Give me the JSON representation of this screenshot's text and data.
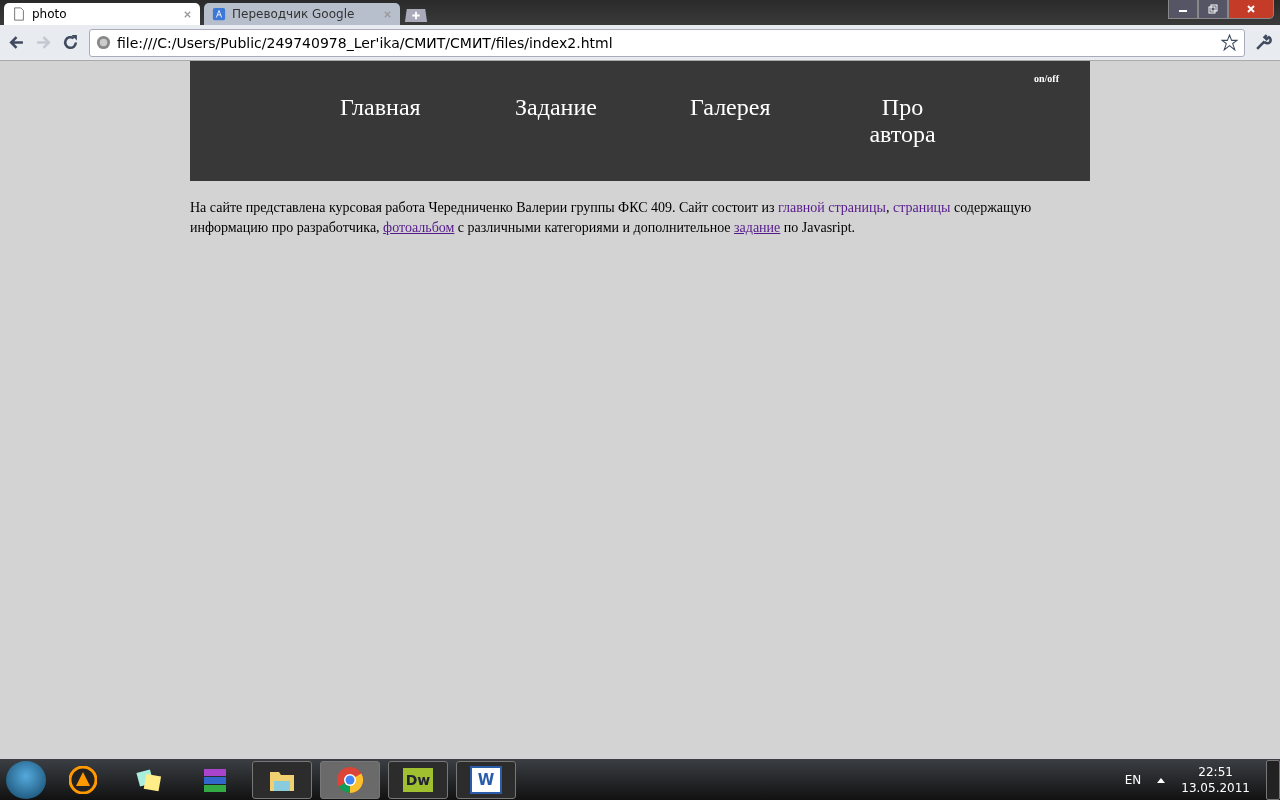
{
  "browser": {
    "tabs": [
      {
        "label": "photo",
        "selected": true,
        "kind": "page"
      },
      {
        "label": "Переводчик Google",
        "selected": false,
        "kind": "translate"
      }
    ],
    "address": "file:///C:/Users/Public/249740978_Ler'ika/СМИТ/СМИТ/files/index2.html",
    "forward_disabled": true
  },
  "page": {
    "toggle": "on/off",
    "nav": [
      {
        "label": "Главная"
      },
      {
        "label": "Задание"
      },
      {
        "label": "Галерея"
      },
      {
        "label": "Про автора"
      }
    ],
    "paragraph": [
      {
        "kind": "text",
        "text": "На сайте представлена курсовая работа Чередниченко Валерии группы ФКС 409. Сайт состоит из "
      },
      {
        "kind": "link",
        "text": "главной страницы",
        "underlined": false
      },
      {
        "kind": "text",
        "text": ", "
      },
      {
        "kind": "link",
        "text": "страницы",
        "underlined": false
      },
      {
        "kind": "text",
        "text": " содержащую информацию про разработчика, "
      },
      {
        "kind": "link",
        "text": "фотоальбом",
        "underlined": true
      },
      {
        "kind": "text",
        "text": " с различными категориями и дополнительное "
      },
      {
        "kind": "link",
        "text": "задание",
        "underlined": true
      },
      {
        "kind": "text",
        "text": " по Javasript."
      }
    ]
  },
  "taskbar": {
    "apps": [
      {
        "kind": "aimp",
        "running": false,
        "selected": false
      },
      {
        "kind": "notes",
        "running": false,
        "selected": false
      },
      {
        "kind": "archive",
        "running": false,
        "selected": false
      },
      {
        "kind": "folder",
        "running": true,
        "selected": false
      },
      {
        "kind": "chrome",
        "running": true,
        "selected": true
      },
      {
        "kind": "dw",
        "running": true,
        "selected": false,
        "label": "Dw"
      },
      {
        "kind": "word",
        "running": true,
        "selected": false,
        "label": "W"
      }
    ],
    "language": "EN",
    "time": "22:51",
    "date": "13.05.2011"
  }
}
